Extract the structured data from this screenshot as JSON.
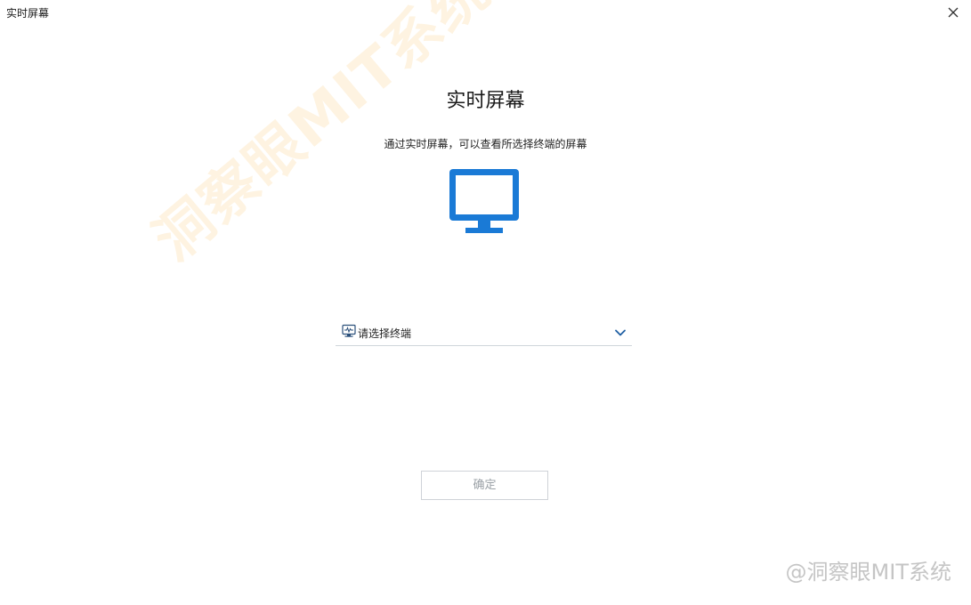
{
  "window": {
    "title": "实时屏幕"
  },
  "main": {
    "heading": "实时屏幕",
    "subtitle": "通过实时屏幕，可以查看所选择终端的屏幕"
  },
  "terminal_select": {
    "placeholder": "请选择终端",
    "icon": "terminal-icon"
  },
  "actions": {
    "ok_label": "确定"
  },
  "watermarks": {
    "diagonal": "洞察眼MIT系统",
    "credit": "@洞察眼MIT系统"
  },
  "colors": {
    "accent": "#1a7ad6",
    "chevron": "#1f5fa3",
    "disabled_text": "#9aa0a6",
    "border": "#cfd3d8"
  },
  "icons": {
    "close": "close-icon",
    "monitor": "monitor-icon",
    "chevron": "chevron-down-icon"
  }
}
